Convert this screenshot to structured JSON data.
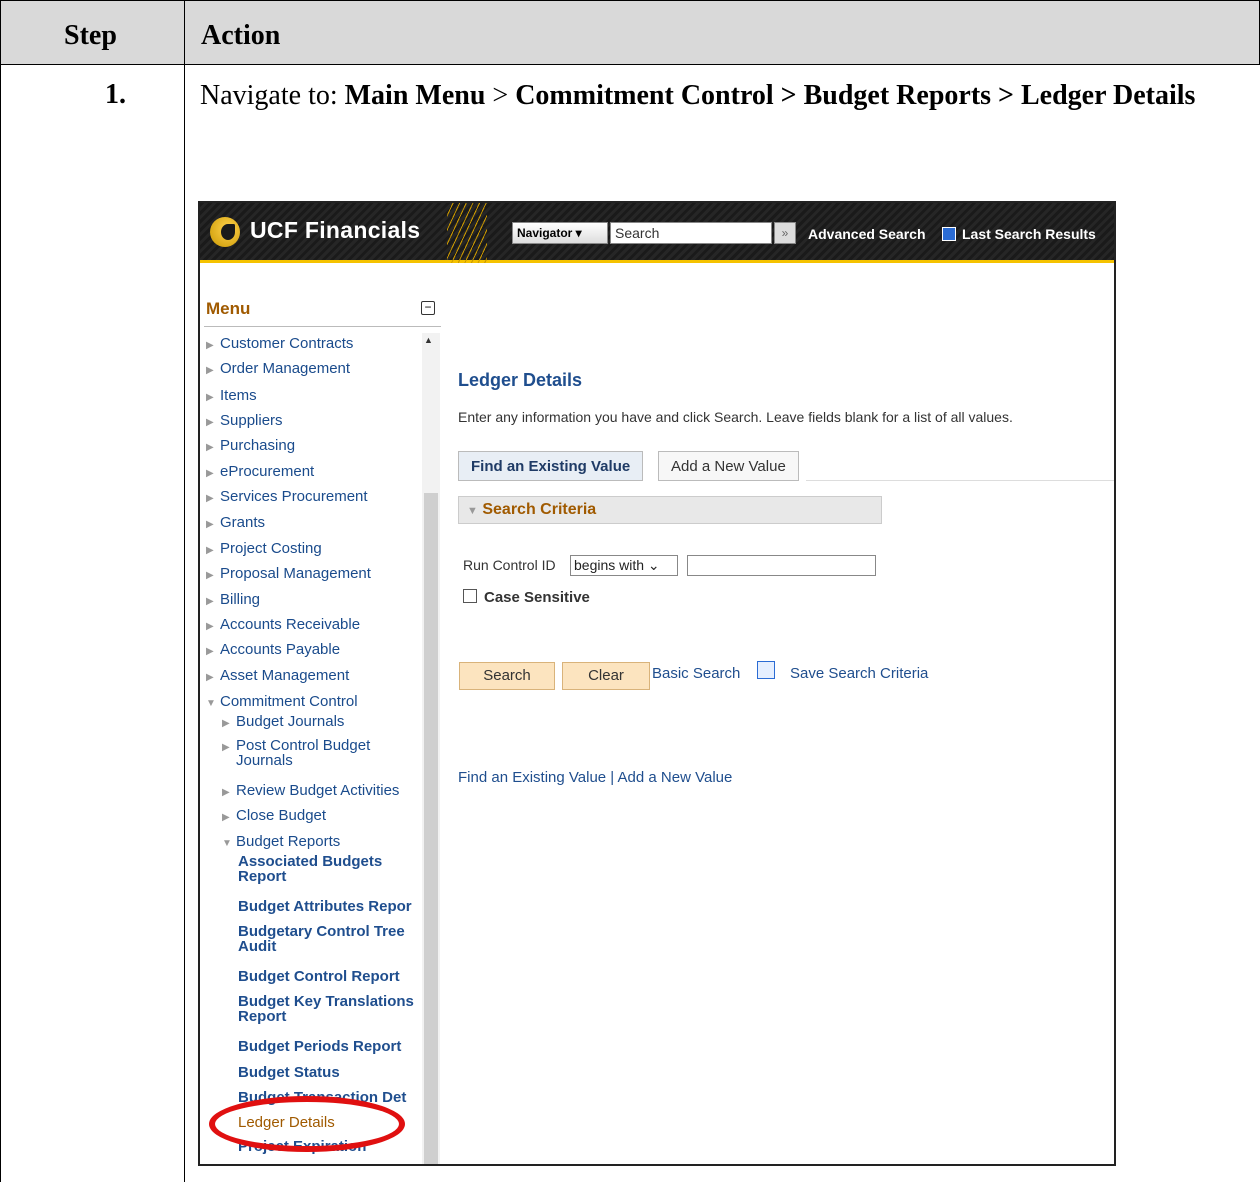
{
  "table": {
    "header_step": "Step",
    "header_action": "Action",
    "step_number": "1.",
    "instruction_prefix": "Navigate to: ",
    "instruction_path_1": "Main Menu",
    "instruction_sep": " > ",
    "instruction_path_2": "Commitment Control > Budget Reports > Ledger Details"
  },
  "app": {
    "title": "UCF Financials",
    "navigator_label": "Navigator ▾",
    "search_placeholder": "Search",
    "advanced_search": "Advanced Search",
    "last_search_results": "Last Search Results"
  },
  "menu": {
    "title": "Menu",
    "items": [
      {
        "label": "Customer Contracts",
        "level": 0
      },
      {
        "label": "Order Management",
        "level": 0
      },
      {
        "label": "Items",
        "level": 0
      },
      {
        "label": "Suppliers",
        "level": 0
      },
      {
        "label": "Purchasing",
        "level": 0
      },
      {
        "label": "eProcurement",
        "level": 0
      },
      {
        "label": "Services Procurement",
        "level": 0
      },
      {
        "label": "Grants",
        "level": 0
      },
      {
        "label": "Project Costing",
        "level": 0
      },
      {
        "label": "Proposal Management",
        "level": 0
      },
      {
        "label": "Billing",
        "level": 0
      },
      {
        "label": "Accounts Receivable",
        "level": 0
      },
      {
        "label": "Accounts Payable",
        "level": 0
      },
      {
        "label": "Asset Management",
        "level": 0
      },
      {
        "label": "Commitment Control",
        "level": 0,
        "expanded": true
      },
      {
        "label": "Budget Journals",
        "level": 1
      },
      {
        "label": "Post Control Budget",
        "label2": "Journals",
        "level": 1
      },
      {
        "label": "Review Budget Activities",
        "level": 1
      },
      {
        "label": "Close Budget",
        "level": 1
      },
      {
        "label": "Budget Reports",
        "level": 1,
        "expanded": true
      },
      {
        "label": "Associated Budgets",
        "label2": "Report",
        "level": 2
      },
      {
        "label": "Budget Attributes Repor",
        "level": 2
      },
      {
        "label": "Budgetary Control Tree",
        "label2": "Audit",
        "level": 2
      },
      {
        "label": "Budget Control Report",
        "level": 2
      },
      {
        "label": "Budget Key Translations",
        "label2": "Report",
        "level": 2
      },
      {
        "label": "Budget Periods Report",
        "level": 2
      },
      {
        "label": "Budget Status",
        "level": 2
      },
      {
        "label": "Budget Transaction Det",
        "level": 2
      },
      {
        "label": "Ledger Details",
        "level": 2,
        "highlighted": true
      },
      {
        "label": "Project Expiration",
        "level": 2
      }
    ]
  },
  "main": {
    "title": "Ledger Details",
    "description": "Enter any information you have and click Search. Leave fields blank for a list of all values.",
    "tab_find": "Find an Existing Value",
    "tab_add": "Add a New Value",
    "criteria_title": "Search Criteria",
    "run_control_label": "Run Control ID",
    "run_control_operator": "begins with ⌄",
    "run_control_value": "",
    "case_sensitive_label": "Case Sensitive",
    "search_button": "Search",
    "clear_button": "Clear",
    "basic_search": "Basic Search",
    "save_search_criteria": "Save Search Criteria",
    "bottom_find": "Find an Existing Value",
    "bottom_sep": " | ",
    "bottom_add": "Add a New Value"
  },
  "colors": {
    "header_gray": "#d9d9d9",
    "ucf_gold": "#f5c200",
    "highlight_oval": "#e01010",
    "link_blue": "#1f4e8e"
  }
}
